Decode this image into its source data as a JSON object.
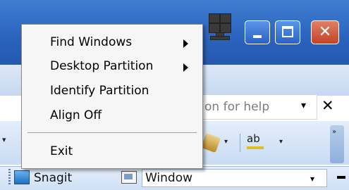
{
  "window": {
    "controls": {
      "minimize_icon": "minimize-icon",
      "maximize_icon": "maximize-icon",
      "close_glyph": "✕"
    },
    "tray_icon": "monitor-icon"
  },
  "help": {
    "text": "on for help",
    "dropdown_glyph": "▾",
    "close_glyph": "✕"
  },
  "toolbar": {
    "left_arrow": "▾",
    "dropdown_glyph": "▾",
    "ab_label": "ab",
    "overflow_glyph": "»"
  },
  "snagit": {
    "label": "Snagit",
    "combo_value": "Window",
    "combo_dropdown": "▾"
  },
  "context_menu": {
    "items": [
      {
        "label": "Find Windows",
        "submenu": true
      },
      {
        "label": "Desktop Partition",
        "submenu": true
      },
      {
        "label": "Identify Partition",
        "submenu": false
      },
      {
        "label": "Align Off",
        "submenu": false
      }
    ],
    "exit_label": "Exit"
  }
}
